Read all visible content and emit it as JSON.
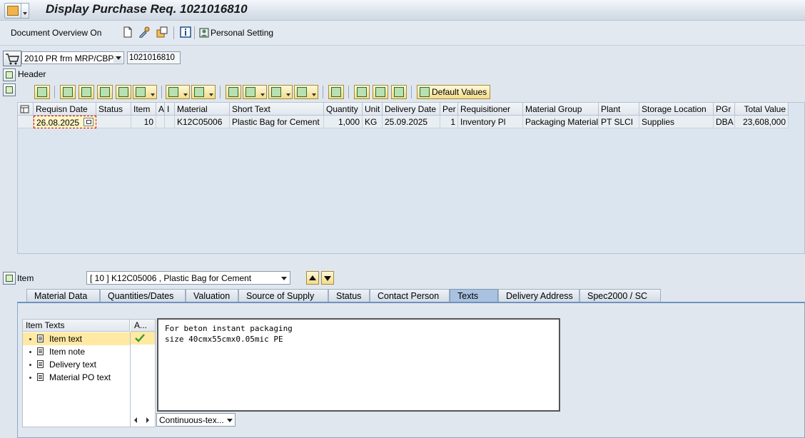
{
  "window": {
    "title": "Display Purchase Req. 1021016810"
  },
  "toolbar": {
    "document_overview": "Document Overview On",
    "personal_setting": "Personal Setting"
  },
  "header": {
    "doc_type": "2010 PR frm MRP/CBP",
    "doc_number": "1021016810",
    "header_label": "Header"
  },
  "grid_toolbar": {
    "default_values": "Default Values"
  },
  "table": {
    "columns": [
      "Requisn Date",
      "Status",
      "Item",
      "A",
      "I",
      "Material",
      "Short Text",
      "Quantity",
      "Unit",
      "Delivery Date",
      "Per",
      "Requisitioner",
      "Material Group",
      "Plant",
      "Storage Location",
      "PGr",
      "Total Value"
    ],
    "row": {
      "requisn_date": "26.08.2025",
      "status": "",
      "item": "10",
      "a": "",
      "i": "",
      "material": "K12C05006",
      "short_text": "Plastic Bag for Cement",
      "quantity": "1,000",
      "unit": "KG",
      "delivery_date": "25.09.2025",
      "per": "1",
      "requisitioner": "Inventory Pl",
      "material_group": "Packaging Material",
      "plant": "PT SLCI",
      "storage_location": "Supplies",
      "pgr": "DBA",
      "total_value": "23,608,000"
    }
  },
  "item_section": {
    "label": "Item",
    "selected": "[ 10 ] K12C05006 , Plastic Bag for Cement"
  },
  "tabs": [
    "Material Data",
    "Quantities/Dates",
    "Valuation",
    "Source of Supply",
    "Status",
    "Contact Person",
    "Texts",
    "Delivery Address",
    "Spec2000 / SC"
  ],
  "active_tab": "Texts",
  "texts": {
    "col1": "Item Texts",
    "col2": "A...",
    "items": [
      "Item text",
      "Item note",
      "Delivery text",
      "Material PO text"
    ],
    "editor_content": "For beton instant packaging\nsize 40cmx55cmx0.05mic PE",
    "format": "Continuous-tex..."
  }
}
